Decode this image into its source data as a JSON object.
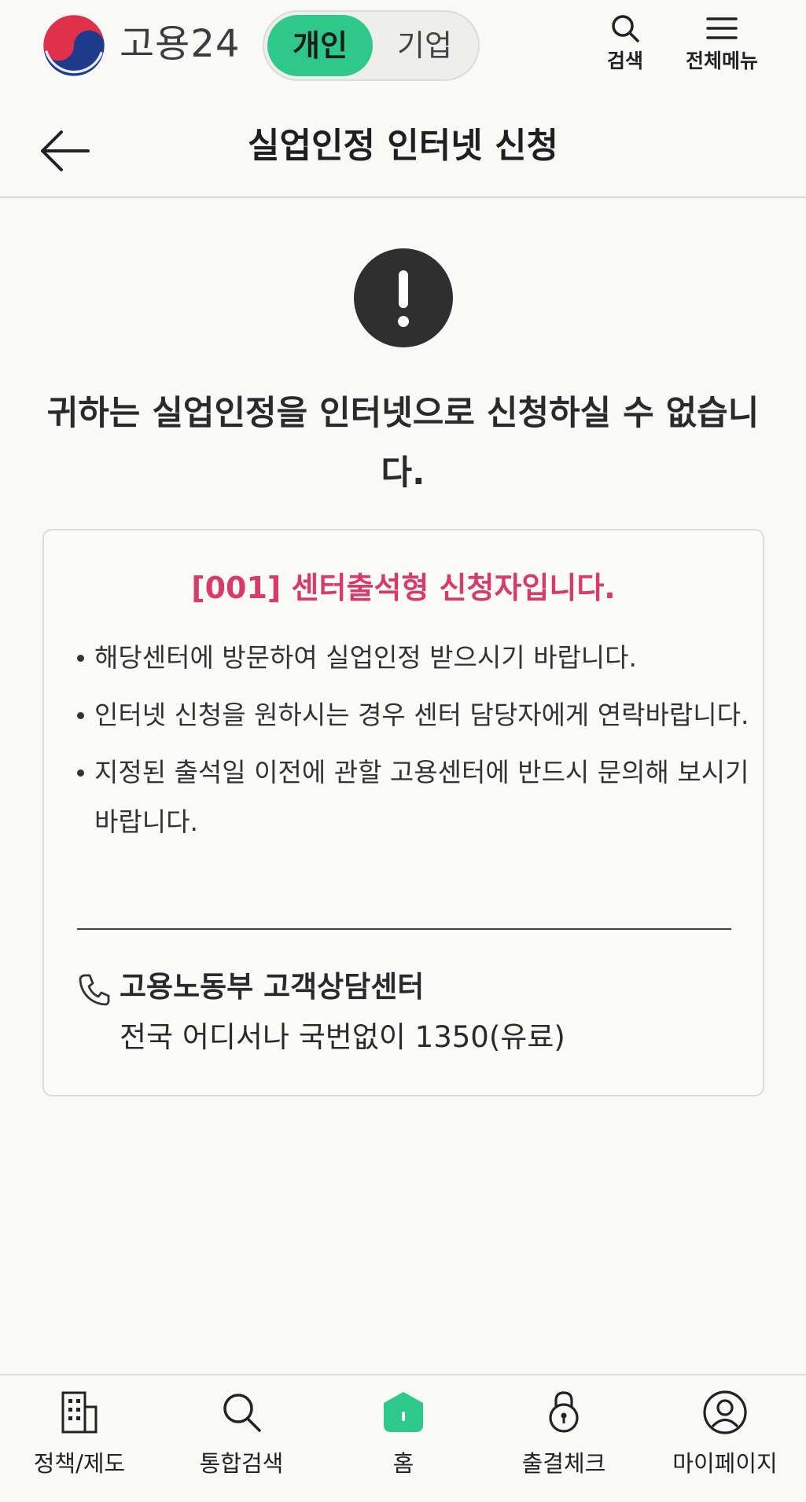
{
  "header": {
    "brand": "고용24",
    "toggle": {
      "active": "개인",
      "inactive": "기업"
    },
    "search_label": "검색",
    "menu_label": "전체메뉴",
    "accent_color": "#2ec98a"
  },
  "subheader": {
    "title": "실업인정 인터넷 신청"
  },
  "main": {
    "alert_icon": "exclamation-icon",
    "headline": "귀하는 실업인정을 인터넷으로 신청하실 수 없습니다.",
    "card": {
      "title": "[001] 센터출석형 신청자입니다.",
      "title_color": "#d93a6e",
      "bullets": [
        "해당센터에 방문하여 실업인정 받으시기 바랍니다.",
        "인터넷 신청을 원하시는 경우 센터 담당자에게 연락바랍니다.",
        "지정된 출석일 이전에 관할 고용센터에 반드시 문의해 보시기 바랍니다."
      ],
      "contact": {
        "icon": "phone-icon",
        "name": "고용노동부 고객상담센터",
        "description": "전국 어디서나 국번없이 1350(유료)"
      }
    }
  },
  "bottom_nav": {
    "items": [
      {
        "label": "정책/제도",
        "icon": "building-icon"
      },
      {
        "label": "통합검색",
        "icon": "search-icon"
      },
      {
        "label": "홈",
        "icon": "home-icon",
        "active": true
      },
      {
        "label": "출결체크",
        "icon": "lock-icon"
      },
      {
        "label": "마이페이지",
        "icon": "user-icon"
      }
    ]
  }
}
